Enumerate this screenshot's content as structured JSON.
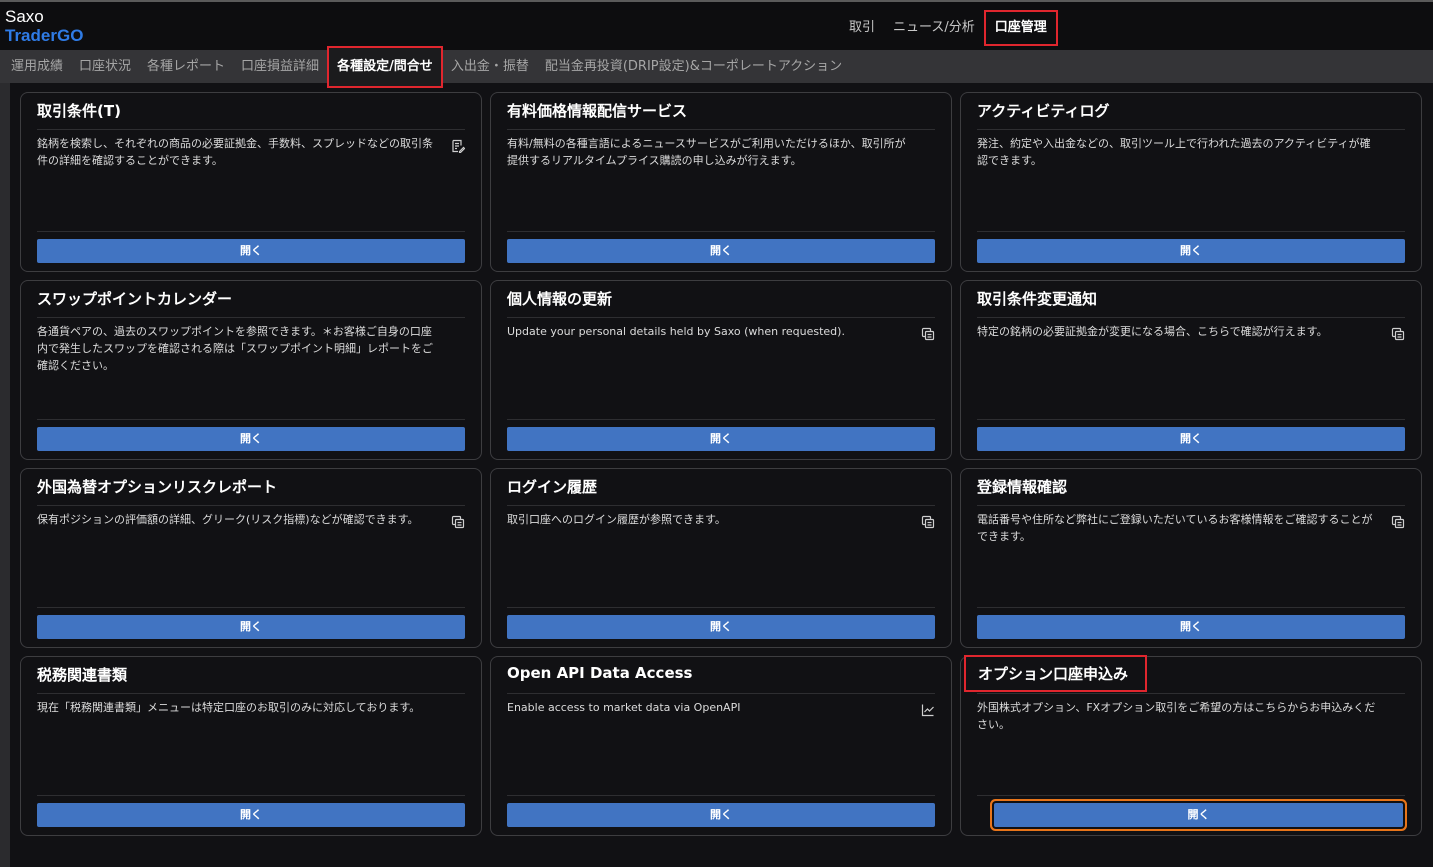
{
  "brand": {
    "line1": "Saxo",
    "line2": "TraderGO"
  },
  "main_nav": [
    {
      "label": "取引",
      "active": false
    },
    {
      "label": "ニュース/分析",
      "active": false
    },
    {
      "label": "口座管理",
      "active": true
    }
  ],
  "sub_nav": [
    {
      "label": "運用成績",
      "active": false
    },
    {
      "label": "口座状況",
      "active": false
    },
    {
      "label": "各種レポート",
      "active": false
    },
    {
      "label": "口座損益詳細",
      "active": false
    },
    {
      "label": "各種設定/問合せ",
      "active": true
    },
    {
      "label": "入出金・振替",
      "active": false
    },
    {
      "label": "配当金再投資(DRIP設定)&コーポレートアクション",
      "active": false
    }
  ],
  "open_label": "開く",
  "cards": [
    {
      "title": "取引条件(T)",
      "desc": "銘柄を検索し、それぞれの商品の必要証拠金、手数料、スプレッドなどの取引条件の詳細を確認することができます。",
      "icon": "edit-note-icon"
    },
    {
      "title": "有料価格情報配信サービス",
      "desc": "有料/無料の各種言語によるニュースサービスがご利用いただけるほか、取引所が提供するリアルタイムプライス購読の申し込みが行えます。",
      "icon": ""
    },
    {
      "title": "アクティビティログ",
      "desc": "発注、約定や入出金などの、取引ツール上で行われた過去のアクティビティが確認できます。",
      "icon": ""
    },
    {
      "title": "スワップポイントカレンダー",
      "desc": "各通貨ペアの、過去のスワップポイントを参照できます。＊お客様ご自身の口座内で発生したスワップを確認される際は「スワップポイント明細」レポートをご確認ください。",
      "icon": ""
    },
    {
      "title": "個人情報の更新",
      "desc": "Update your personal details held by Saxo (when requested).",
      "icon": "copy-icon"
    },
    {
      "title": "取引条件変更通知",
      "desc": "特定の銘柄の必要証拠金が変更になる場合、こちらで確認が行えます。",
      "icon": "copy-icon"
    },
    {
      "title": "外国為替オプションリスクレポート",
      "desc": "保有ポジションの評価額の詳細、グリーク(リスク指標)などが確認できます。",
      "icon": "copy-icon"
    },
    {
      "title": "ログイン履歴",
      "desc": "取引口座へのログイン履歴が参照できます。",
      "icon": "copy-icon"
    },
    {
      "title": "登録情報確認",
      "desc": "電話番号や住所など弊社にご登録いただいているお客様情報をご確認することができます。",
      "icon": "copy-icon"
    },
    {
      "title": "税務関連書類",
      "desc": "現在「税務関連書類」メニューは特定口座のお取引のみに対応しております。",
      "icon": ""
    },
    {
      "title": "Open API Data Access",
      "desc": "Enable access to market data via OpenAPI",
      "icon": "chart-line-icon"
    },
    {
      "title": "オプション口座申込み",
      "desc": "外国株式オプション、FXオプション取引をご希望の方はこちらからお申込みください。",
      "icon": ""
    }
  ]
}
